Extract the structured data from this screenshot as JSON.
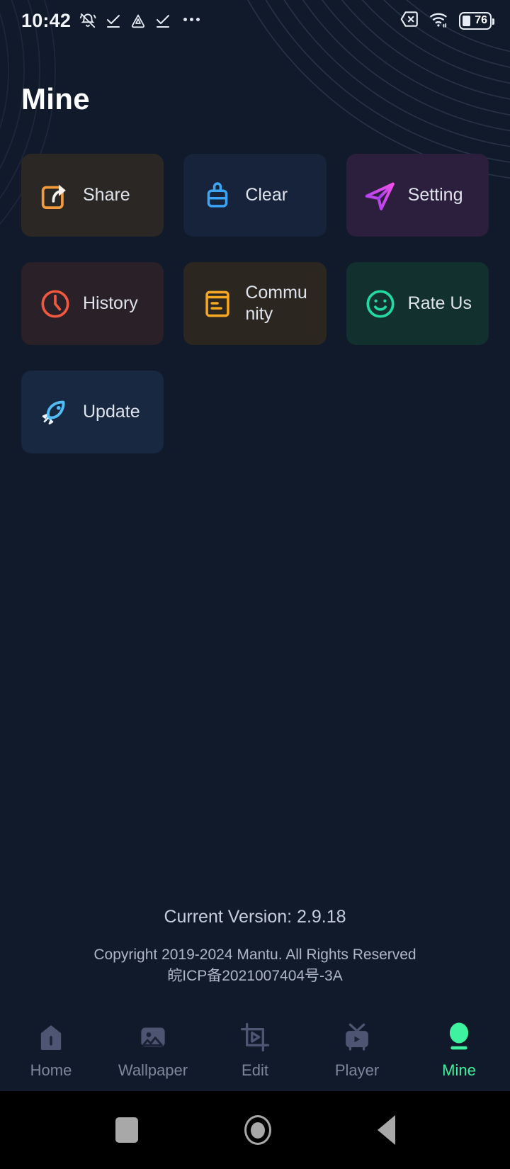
{
  "status_bar": {
    "time": "10:42",
    "left_icons": [
      "mute-bell-icon",
      "check-underline-icon",
      "triangle-drive-icon",
      "check-underline-icon",
      "overflow-dots-icon"
    ],
    "right_icons": [
      "sim-card-off-icon",
      "wifi-icon"
    ],
    "battery_percent": "76"
  },
  "header": {
    "title": "Mine"
  },
  "grid": {
    "items": [
      {
        "key": "share",
        "label": "Share",
        "icon": "share-arrow-icon",
        "accent": "#f29a3c",
        "bg": "#2b2724"
      },
      {
        "key": "clear",
        "label": "Clear",
        "icon": "brush-clean-icon",
        "accent": "#3ba4f7",
        "bg": "#16233a"
      },
      {
        "key": "setting",
        "label": "Setting",
        "icon": "paper-plane-icon",
        "accent": "#e44df2",
        "bg": "#2c1f3d"
      },
      {
        "key": "history",
        "label": "History",
        "icon": "clock-icon",
        "accent": "#f2573f",
        "bg": "#2a2027"
      },
      {
        "key": "community",
        "label": "Community",
        "icon": "document-list-icon",
        "accent": "#f5a623",
        "bg": "#2b2620"
      },
      {
        "key": "rateus",
        "label": "Rate Us",
        "icon": "smiley-face-icon",
        "accent": "#22d9a0",
        "bg": "#12302e"
      },
      {
        "key": "update",
        "label": "Update",
        "icon": "rocket-icon",
        "accent": "#52bdf5",
        "bg": "#172840"
      }
    ]
  },
  "footer": {
    "version": "Current Version: 2.9.18",
    "copyright_line1": "Copyright  2019-2024 Mantu. All Rights Reserved",
    "copyright_line2": "皖ICP备2021007404号-3A"
  },
  "tabbar": {
    "active_color": "#3ef2a0",
    "inactive_color": "#7d869c",
    "items": [
      {
        "key": "home",
        "label": "Home",
        "icon": "house-icon",
        "active": false
      },
      {
        "key": "wallpaper",
        "label": "Wallpaper",
        "icon": "image-icon",
        "active": false
      },
      {
        "key": "edit",
        "label": "Edit",
        "icon": "crop-play-icon",
        "active": false
      },
      {
        "key": "player",
        "label": "Player",
        "icon": "tv-play-icon",
        "active": false
      },
      {
        "key": "mine",
        "label": "Mine",
        "icon": "avatar-icon",
        "active": true
      }
    ]
  },
  "system_nav": {
    "recent_label": "recents-button",
    "home_label": "home-button",
    "back_label": "back-button"
  }
}
